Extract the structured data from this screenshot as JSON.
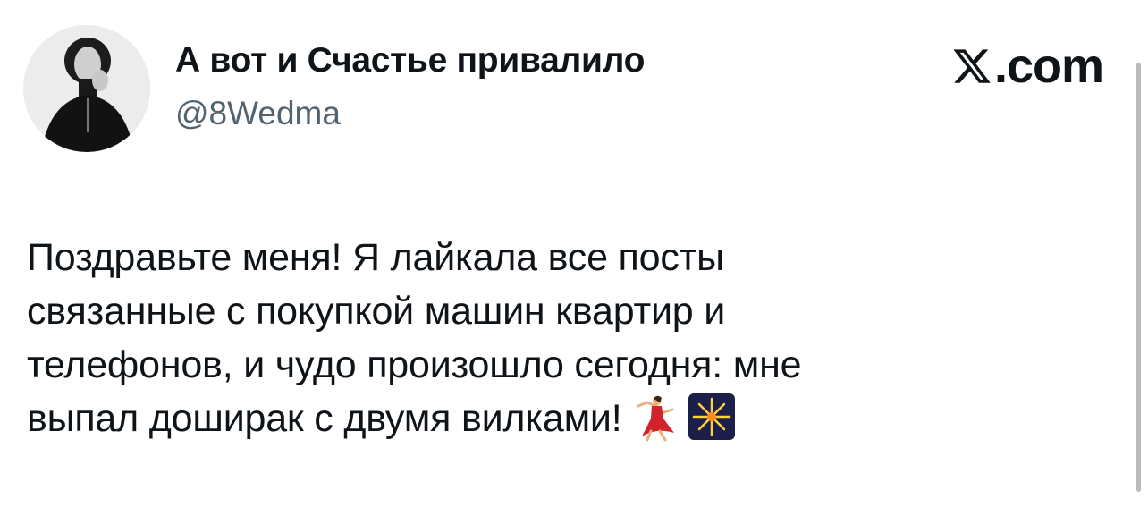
{
  "tweet": {
    "author_name": "А вот и Счастье привалило",
    "author_handle": "@8Wedma",
    "brand_domain": ".com",
    "brand_icon": "x-logo-icon",
    "avatar_icon": "profile-photo-avatar",
    "text_lines": [
      "Поздравьте меня! Я лайкала все посты",
      "связанные с покупкой машин квартир и",
      "телефонов, и чудо произошло сегодня: мне",
      "выпал доширак с двумя вилками!"
    ],
    "emojis": [
      "dancer-emoji-icon",
      "fireworks-emoji-icon"
    ]
  },
  "colors": {
    "text": "#0f1419",
    "secondary": "#536471",
    "background": "#ffffff"
  }
}
